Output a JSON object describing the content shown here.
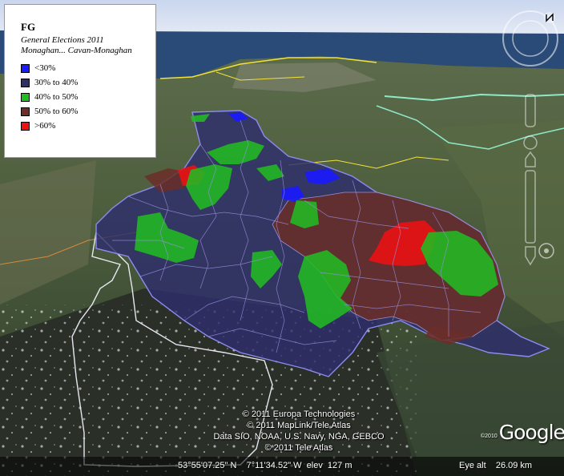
{
  "legend": {
    "title": "FG",
    "subtitle_line1": "General Elections  2011",
    "subtitle_line2": "Monaghan... Cavan-Monaghan",
    "items": [
      {
        "label": "<30%",
        "color": "#1a1aff"
      },
      {
        "label": "30% to 40%",
        "color": "#2e2e6b"
      },
      {
        "label": "40% to 50%",
        "color": "#22bb22"
      },
      {
        "label": "50% to 60%",
        "color": "#6b2e28"
      },
      {
        "label": ">60%",
        "color": "#ee1111"
      }
    ]
  },
  "attribution": [
    "© 2011 Europa Technologies",
    "© 2011 MapLink/Tele Atlas",
    "Data SIO, NOAA, U.S. Navy, NGA, GEBCO",
    "© 2011 Tele Atlas"
  ],
  "status": {
    "coordinates": "53°55'07.25\" N    7°11'34.52\" W  elev  127 m",
    "eye_alt": "Eye alt    26.09 km"
  },
  "logo": {
    "year": "©2010",
    "word": "Google"
  },
  "nav_icons": [
    "compass-icon",
    "north-arrow-icon",
    "look-joystick-icon",
    "move-joystick-icon",
    "zoom-slider-icon"
  ]
}
